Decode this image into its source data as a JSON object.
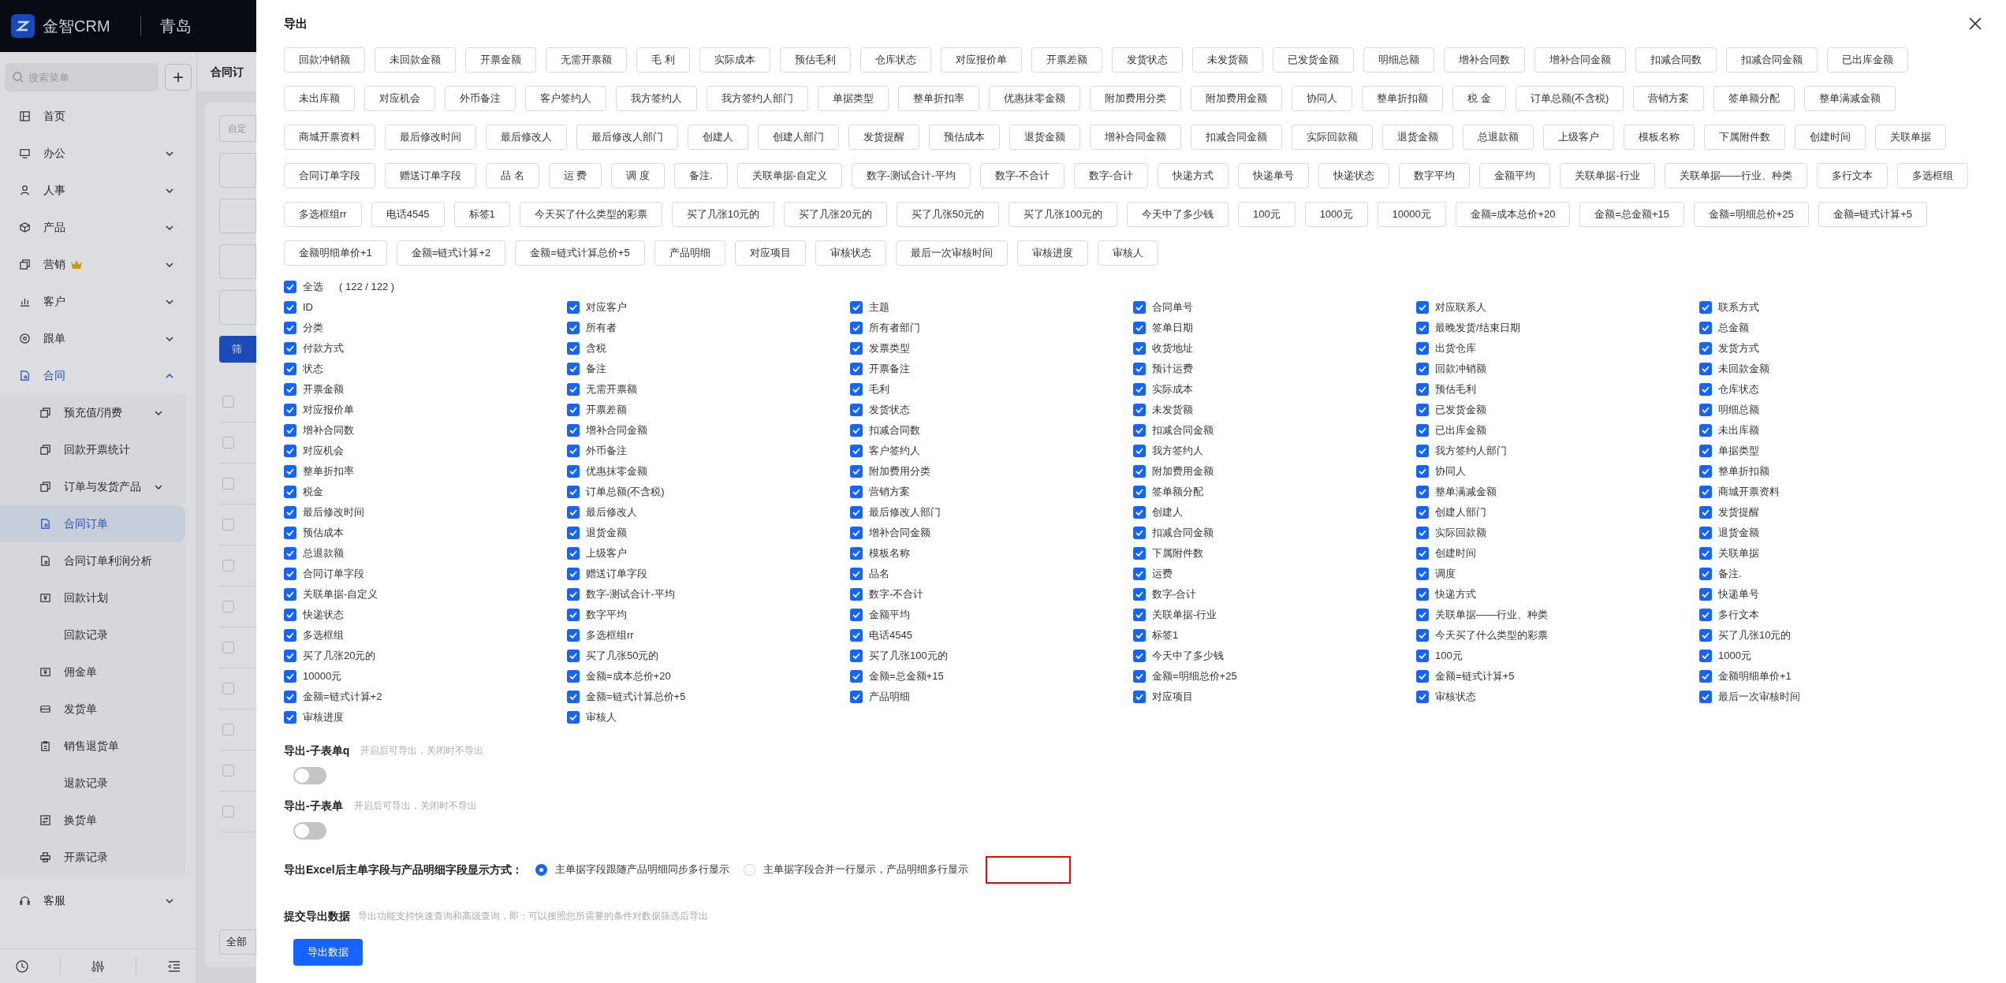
{
  "app_header": {
    "logo_text": "金智CRM",
    "company": "青岛"
  },
  "sidebar": {
    "search_placeholder": "搜索菜单",
    "add_button": "+",
    "items": [
      {
        "label": "首页",
        "kind": "link",
        "premium": false,
        "selected": false
      },
      {
        "label": "办公",
        "kind": "group",
        "premium": false,
        "expanded": false,
        "selected": false
      },
      {
        "label": "人事",
        "kind": "group",
        "premium": false,
        "expanded": false,
        "selected": false
      },
      {
        "label": "产品",
        "kind": "group",
        "premium": false,
        "expanded": false,
        "selected": false
      },
      {
        "label": "营销",
        "kind": "group",
        "premium": true,
        "expanded": false,
        "selected": false
      },
      {
        "label": "客户",
        "kind": "group",
        "premium": false,
        "expanded": false,
        "selected": false
      },
      {
        "label": "跟单",
        "kind": "group",
        "premium": false,
        "expanded": false,
        "selected": false
      },
      {
        "label": "合同",
        "kind": "group",
        "premium": false,
        "expanded": true,
        "selected": false,
        "children": [
          {
            "label": "预充值/消费",
            "kind": "group",
            "expanded": false,
            "selected": false
          },
          {
            "label": "回款开票统计",
            "kind": "link",
            "selected": false
          },
          {
            "label": "订单与发货产品",
            "kind": "group",
            "expanded": false,
            "selected": false
          },
          {
            "label": "合同订单",
            "kind": "link",
            "selected": true
          },
          {
            "label": "合同订单利润分析",
            "kind": "link",
            "selected": false
          },
          {
            "label": "回款计划",
            "kind": "link",
            "selected": false
          },
          {
            "label": "回款记录",
            "kind": "link",
            "selected": false
          },
          {
            "label": "佣金单",
            "kind": "link",
            "selected": false
          },
          {
            "label": "发货单",
            "kind": "link",
            "selected": false
          },
          {
            "label": "销售退货单",
            "kind": "link",
            "selected": false
          },
          {
            "label": "退款记录",
            "kind": "link",
            "selected": false
          },
          {
            "label": "换货单",
            "kind": "link",
            "selected": false
          },
          {
            "label": "开票记录",
            "kind": "link",
            "selected": false
          }
        ]
      },
      {
        "label": "客服",
        "kind": "group",
        "premium": false,
        "expanded": false,
        "selected": false
      }
    ]
  },
  "background_page": {
    "title": "合同订",
    "filter_placeholder": "自定",
    "filter_button": "筛",
    "footer_button": "全部",
    "table_rows": [
      {
        "checked": false
      },
      {
        "checked": false
      },
      {
        "checked": false
      },
      {
        "checked": false
      },
      {
        "checked": false
      },
      {
        "checked": false
      },
      {
        "checked": false
      },
      {
        "checked": false
      },
      {
        "checked": false
      },
      {
        "checked": false
      },
      {
        "checked": false
      }
    ]
  },
  "export_dialog": {
    "title": "导出",
    "field_chips": [
      "回款冲销额",
      "未回款金额",
      "开票金额",
      "无需开票额",
      "毛 利",
      "实际成本",
      "预估毛利",
      "仓库状态",
      "对应报价单",
      "开票差额",
      "发货状态",
      "未发货额",
      "已发货金额",
      "明细总额",
      "增补合同数",
      "增补合同金额",
      "扣减合同数",
      "扣减合同金额",
      "已出库金额",
      "未出库额",
      "对应机会",
      "外币备注",
      "客户签约人",
      "我方签约人",
      "我方签约人部门",
      "单据类型",
      "整单折扣率",
      "优惠抹零金额",
      "附加费用分类",
      "附加费用金额",
      "协同人",
      "整单折扣额",
      "税 金",
      "订单总额(不含税)",
      "营销方案",
      "签单额分配",
      "整单满减金额",
      "商城开票资料",
      "最后修改时间",
      "最后修改人",
      "最后修改人部门",
      "创建人",
      "创建人部门",
      "发货提醒",
      "预估成本",
      "退货金额",
      "增补合同金额",
      "扣减合同金额",
      "实际回款额",
      "退货金额",
      "总退款额",
      "上级客户",
      "模板名称",
      "下属附件数",
      "创建时间",
      "关联单据",
      "合同订单字段",
      "赠送订单字段",
      "品 名",
      "运 费",
      "调 度",
      "备注.",
      "关联单据-自定义",
      "数字-测试合计-平均",
      "数字-不合计",
      "数字-合计",
      "快递方式",
      "快递单号",
      "快递状态",
      "数字平均",
      "金额平均",
      "关联单据-行业",
      "关联单据——行业、种类",
      "多行文本",
      "多选框组",
      "多选框组rr",
      "电话4545",
      "标签1",
      "今天买了什么类型的彩票",
      "买了几张10元的",
      "买了几张20元的",
      "买了几张50元的",
      "买了几张100元的",
      "今天中了多少钱",
      "100元",
      "1000元",
      "10000元",
      "金额=成本总价+20",
      "金额=总金额+15",
      "金额=明细总价+25",
      "金额=链式计算+5",
      "金额明细单价+1",
      "金额=链式计算+2",
      "金额=链式计算总价+5",
      "产品明细",
      "对应项目",
      "审核状态",
      "最后一次审核时间",
      "审核进度",
      "审核人"
    ],
    "select_all": {
      "label": "全选",
      "count": "( 122 / 122 )",
      "checked": true
    },
    "fields": [
      {
        "label": "ID",
        "checked": true
      },
      {
        "label": "对应客户",
        "checked": true
      },
      {
        "label": "主题",
        "checked": true
      },
      {
        "label": "合同单号",
        "checked": true
      },
      {
        "label": "对应联系人",
        "checked": true
      },
      {
        "label": "联系方式",
        "checked": true
      },
      {
        "label": "分类",
        "checked": true
      },
      {
        "label": "所有者",
        "checked": true
      },
      {
        "label": "所有者部门",
        "checked": true
      },
      {
        "label": "签单日期",
        "checked": true
      },
      {
        "label": "最晚发货/结束日期",
        "checked": true
      },
      {
        "label": "总金额",
        "checked": true
      },
      {
        "label": "付款方式",
        "checked": true
      },
      {
        "label": "含税",
        "checked": true
      },
      {
        "label": "发票类型",
        "checked": true
      },
      {
        "label": "收货地址",
        "checked": true
      },
      {
        "label": "出货仓库",
        "checked": true
      },
      {
        "label": "发货方式",
        "checked": true
      },
      {
        "label": "状态",
        "checked": true
      },
      {
        "label": "备注",
        "checked": true
      },
      {
        "label": "开票备注",
        "checked": true
      },
      {
        "label": "预计运费",
        "checked": true
      },
      {
        "label": "回款冲销额",
        "checked": true
      },
      {
        "label": "未回款金额",
        "checked": true
      },
      {
        "label": "开票金额",
        "checked": true
      },
      {
        "label": "无需开票额",
        "checked": true
      },
      {
        "label": "毛利",
        "checked": true
      },
      {
        "label": "实际成本",
        "checked": true
      },
      {
        "label": "预估毛利",
        "checked": true
      },
      {
        "label": "仓库状态",
        "checked": true
      },
      {
        "label": "对应报价单",
        "checked": true
      },
      {
        "label": "开票差额",
        "checked": true
      },
      {
        "label": "发货状态",
        "checked": true
      },
      {
        "label": "未发货额",
        "checked": true
      },
      {
        "label": "已发货金额",
        "checked": true
      },
      {
        "label": "明细总额",
        "checked": true
      },
      {
        "label": "增补合同数",
        "checked": true
      },
      {
        "label": "增补合同金额",
        "checked": true
      },
      {
        "label": "扣减合同数",
        "checked": true
      },
      {
        "label": "扣减合同金额",
        "checked": true
      },
      {
        "label": "已出库金额",
        "checked": true
      },
      {
        "label": "未出库额",
        "checked": true
      },
      {
        "label": "对应机会",
        "checked": true
      },
      {
        "label": "外币备注",
        "checked": true
      },
      {
        "label": "客户签约人",
        "checked": true
      },
      {
        "label": "我方签约人",
        "checked": true
      },
      {
        "label": "我方签约人部门",
        "checked": true
      },
      {
        "label": "单据类型",
        "checked": true
      },
      {
        "label": "整单折扣率",
        "checked": true
      },
      {
        "label": "优惠抹零金额",
        "checked": true
      },
      {
        "label": "附加费用分类",
        "checked": true
      },
      {
        "label": "附加费用金额",
        "checked": true
      },
      {
        "label": "协同人",
        "checked": true
      },
      {
        "label": "整单折扣额",
        "checked": true
      },
      {
        "label": "税金",
        "checked": true
      },
      {
        "label": "订单总额(不含税)",
        "checked": true
      },
      {
        "label": "营销方案",
        "checked": true
      },
      {
        "label": "签单额分配",
        "checked": true
      },
      {
        "label": "整单满减金额",
        "checked": true
      },
      {
        "label": "商城开票资料",
        "checked": true
      },
      {
        "label": "最后修改时间",
        "checked": true
      },
      {
        "label": "最后修改人",
        "checked": true
      },
      {
        "label": "最后修改人部门",
        "checked": true
      },
      {
        "label": "创建人",
        "checked": true
      },
      {
        "label": "创建人部门",
        "checked": true
      },
      {
        "label": "发货提醒",
        "checked": true
      },
      {
        "label": "预估成本",
        "checked": true
      },
      {
        "label": "退货金额",
        "checked": true
      },
      {
        "label": "增补合同金额",
        "checked": true
      },
      {
        "label": "扣减合同金额",
        "checked": true
      },
      {
        "label": "实际回款额",
        "checked": true
      },
      {
        "label": "退货金额",
        "checked": true
      },
      {
        "label": "总退款额",
        "checked": true
      },
      {
        "label": "上级客户",
        "checked": true
      },
      {
        "label": "模板名称",
        "checked": true
      },
      {
        "label": "下属附件数",
        "checked": true
      },
      {
        "label": "创建时间",
        "checked": true
      },
      {
        "label": "关联单据",
        "checked": true
      },
      {
        "label": "合同订单字段",
        "checked": true
      },
      {
        "label": "赠送订单字段",
        "checked": true
      },
      {
        "label": "品名",
        "checked": true
      },
      {
        "label": "运费",
        "checked": true
      },
      {
        "label": "调度",
        "checked": true
      },
      {
        "label": "备注.",
        "checked": true
      },
      {
        "label": "关联单据-自定义",
        "checked": true
      },
      {
        "label": "数字-测试合计-平均",
        "checked": true
      },
      {
        "label": "数字-不合计",
        "checked": true
      },
      {
        "label": "数字-合计",
        "checked": true
      },
      {
        "label": "快递方式",
        "checked": true
      },
      {
        "label": "快递单号",
        "checked": true
      },
      {
        "label": "快递状态",
        "checked": true
      },
      {
        "label": "数字平均",
        "checked": true
      },
      {
        "label": "金额平均",
        "checked": true
      },
      {
        "label": "关联单据-行业",
        "checked": true
      },
      {
        "label": "关联单据——行业、种类",
        "checked": true
      },
      {
        "label": "多行文本",
        "checked": true
      },
      {
        "label": "多选框组",
        "checked": true
      },
      {
        "label": "多选框组rr",
        "checked": true
      },
      {
        "label": "电话4545",
        "checked": true
      },
      {
        "label": "标签1",
        "checked": true
      },
      {
        "label": "今天买了什么类型的彩票",
        "checked": true
      },
      {
        "label": "买了几张10元的",
        "checked": true
      },
      {
        "label": "买了几张20元的",
        "checked": true
      },
      {
        "label": "买了几张50元的",
        "checked": true
      },
      {
        "label": "买了几张100元的",
        "checked": true
      },
      {
        "label": "今天中了多少钱",
        "checked": true
      },
      {
        "label": "100元",
        "checked": true
      },
      {
        "label": "1000元",
        "checked": true
      },
      {
        "label": "10000元",
        "checked": true
      },
      {
        "label": "金额=成本总价+20",
        "checked": true
      },
      {
        "label": "金额=总金额+15",
        "checked": true
      },
      {
        "label": "金额=明细总价+25",
        "checked": true
      },
      {
        "label": "金额=链式计算+5",
        "checked": true
      },
      {
        "label": "金额明细单价+1",
        "checked": true
      },
      {
        "label": "金额=链式计算+2",
        "checked": true
      },
      {
        "label": "金额=链式计算总价+5",
        "checked": true
      },
      {
        "label": "产品明细",
        "checked": true
      },
      {
        "label": "对应项目",
        "checked": true
      },
      {
        "label": "审核状态",
        "checked": true
      },
      {
        "label": "最后一次审核时间",
        "checked": true
      },
      {
        "label": "审核进度",
        "checked": true
      },
      {
        "label": "审核人",
        "checked": true
      }
    ],
    "subform_sections": [
      {
        "title": "导出-子表单q",
        "hint": "开启后可导出，关闭时不导出",
        "on": false
      },
      {
        "title": "导出-子表单",
        "hint": "开启后可导出，关闭时不导出",
        "on": false
      }
    ],
    "display_mode": {
      "label": "导出Excel后主单字段与产品明细字段显示方式：",
      "options": [
        {
          "label": "主单据字段跟随产品明细同步多行显示",
          "selected": true
        },
        {
          "label": "主单据字段合并一行显示，产品明细多行显示",
          "selected": false
        }
      ]
    },
    "submit": {
      "title": "提交导出数据",
      "hint": "导出功能支持快速查询和高级查询，即：可以按照您所需要的条件对数据筛选后导出",
      "button": "导出数据"
    }
  }
}
